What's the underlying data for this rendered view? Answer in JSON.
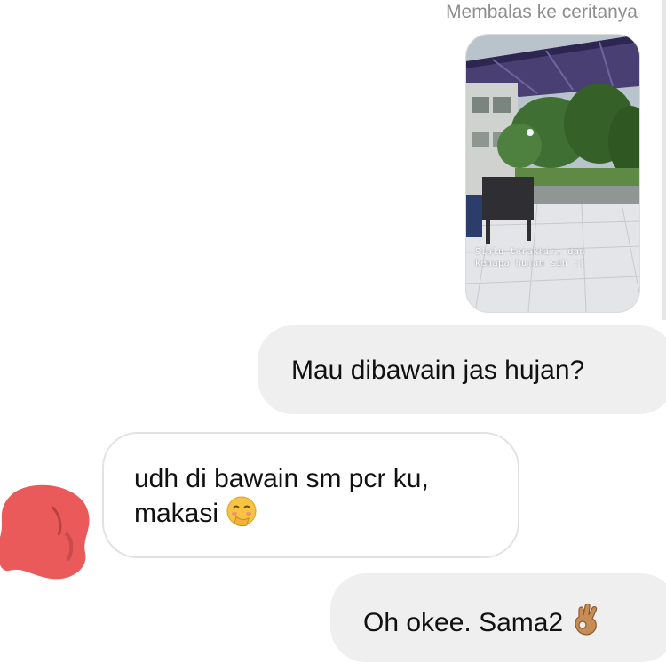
{
  "reply_header": {
    "text": "Membalas ke ceritanya"
  },
  "story": {
    "caption_line1": "Slalu terakhir, dan",
    "caption_line2": "kenapa hujan sih :("
  },
  "messages": [
    {
      "sender": "me",
      "text": "Mau dibawain jas hujan?"
    },
    {
      "sender": "them",
      "line1": "udh di bawain sm pcr ku,",
      "line2": "makasi",
      "emoji": "blushing-face-with-hand-over-mouth"
    },
    {
      "sender": "me",
      "text": "Oh okee. Sama2",
      "emoji": "ok-hand"
    }
  ],
  "colors": {
    "outgoing_bubble": "#efefef",
    "incoming_bubble_border": "#e2e2e2",
    "avatar_scribble": "#ea5a5a",
    "caption_gray": "#8e8e8e"
  }
}
